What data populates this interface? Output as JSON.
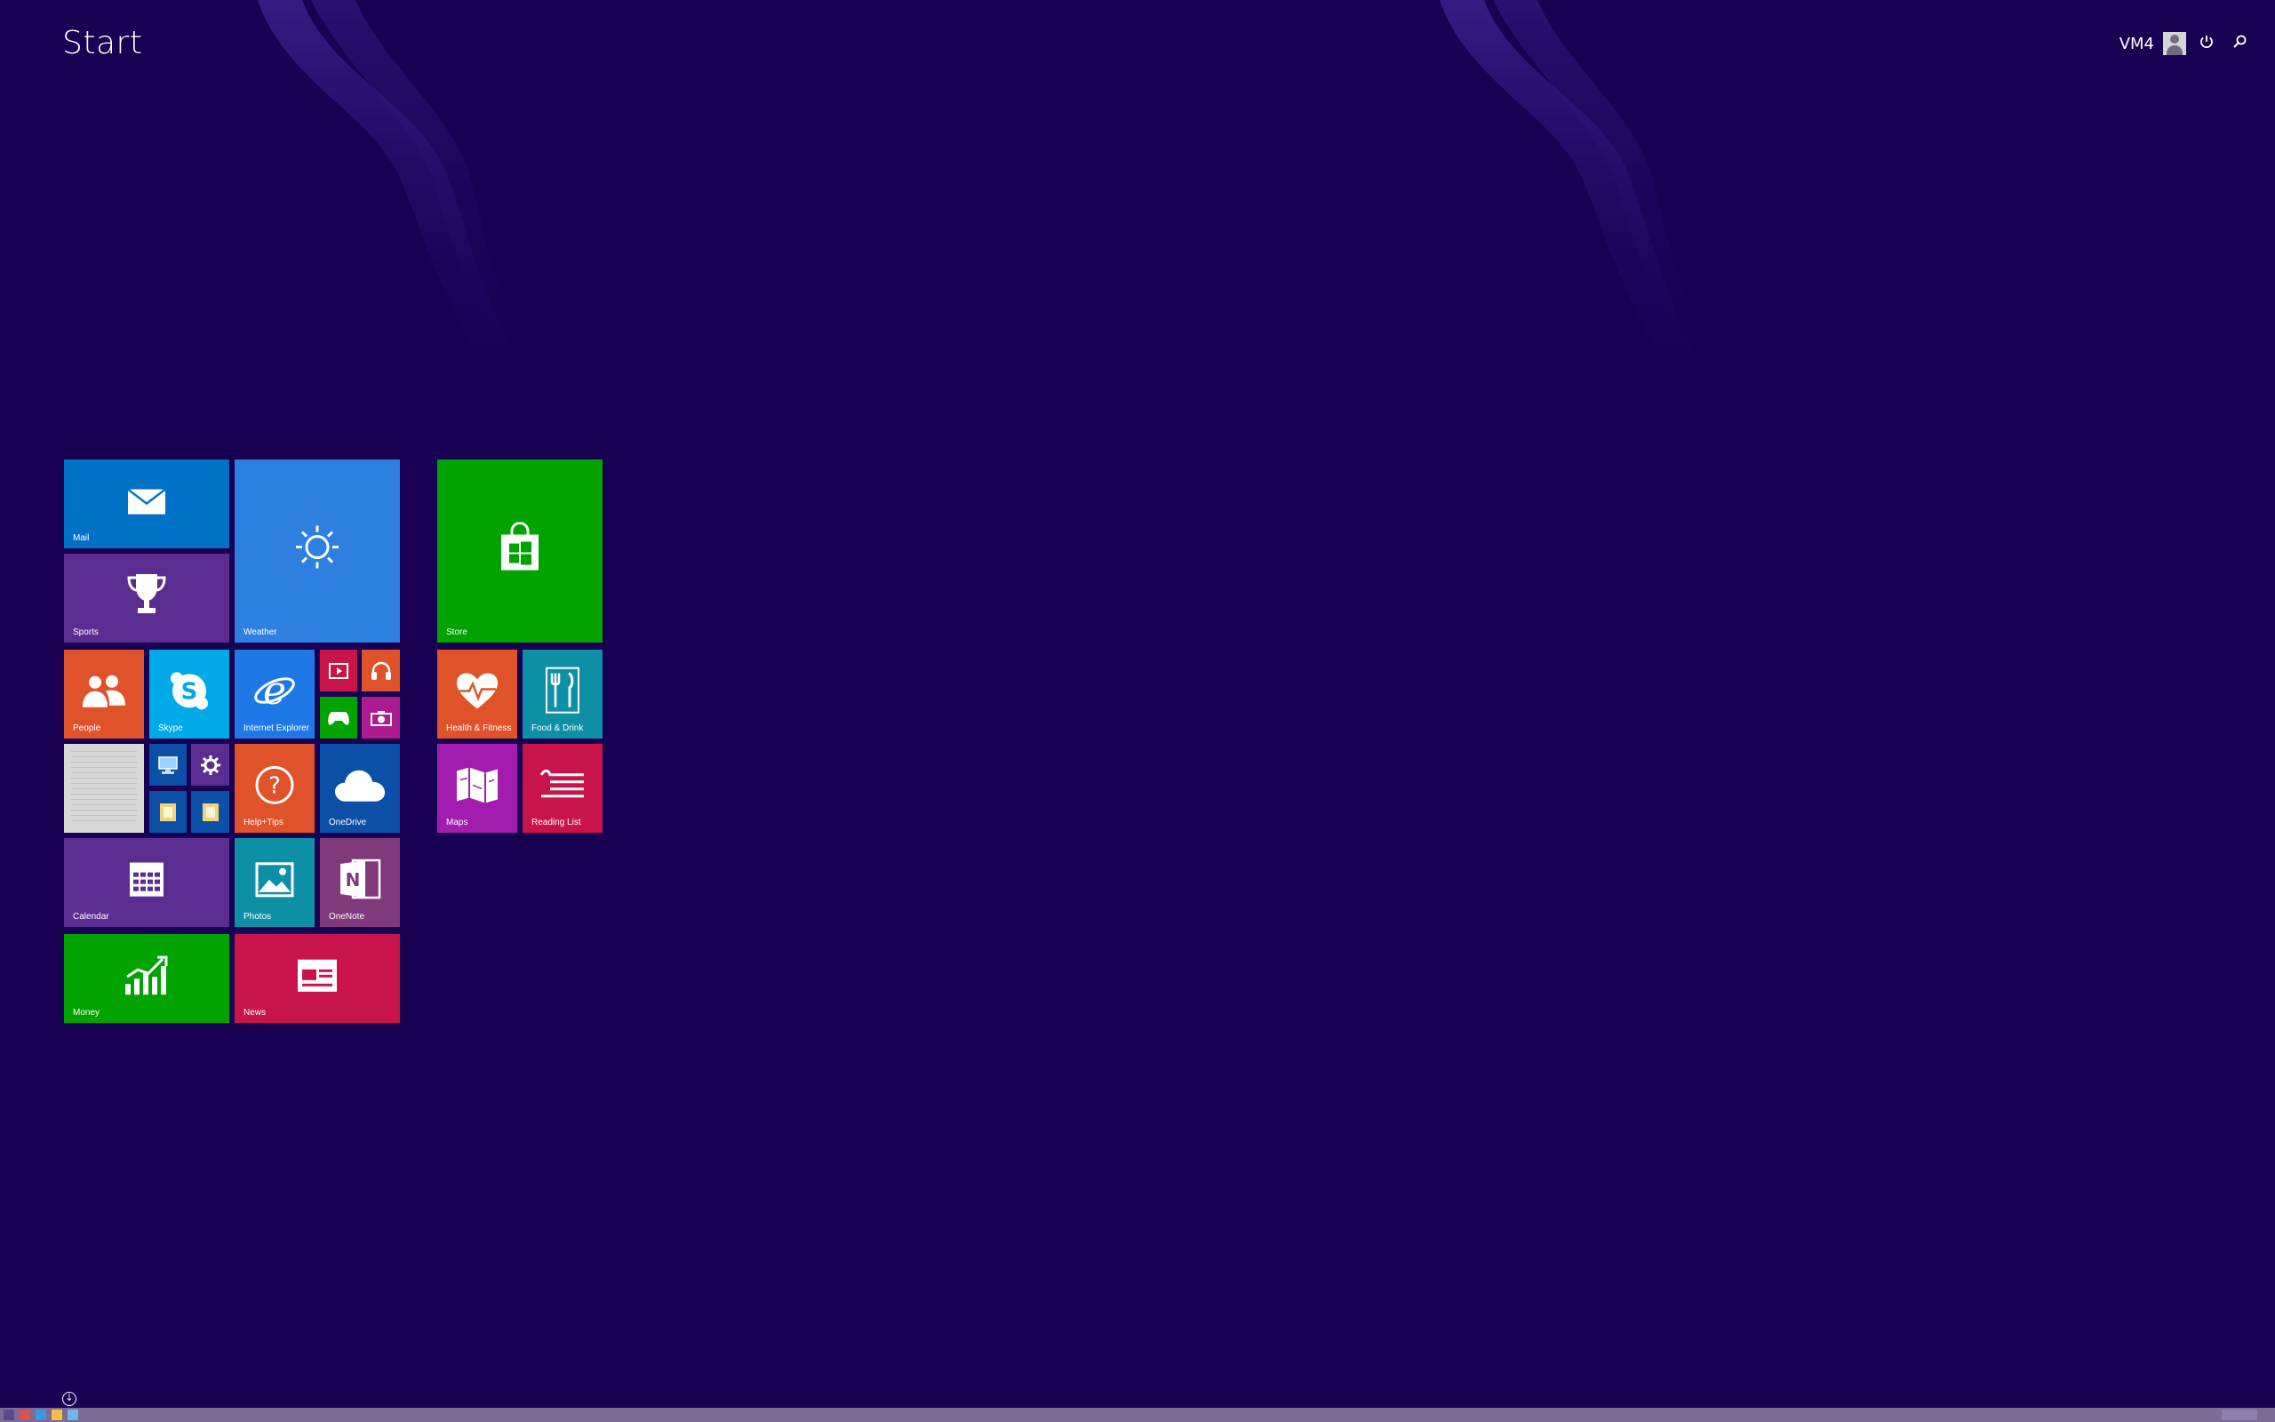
{
  "header": {
    "title": "Start",
    "user_name": "VM4",
    "power_icon": "power-icon",
    "search_icon": "search-icon"
  },
  "colors": {
    "background": "#180052",
    "taskbar": "#7d6b95"
  },
  "tiles": [
    {
      "id": "mail",
      "label": "Mail",
      "color": "#0072c6",
      "icon": "mail-icon"
    },
    {
      "id": "sports",
      "label": "Sports",
      "color": "#5c2d91",
      "icon": "trophy-icon"
    },
    {
      "id": "weather",
      "label": "Weather",
      "color": "#2d7fe0",
      "icon": "sun-icon"
    },
    {
      "id": "store",
      "label": "Store",
      "color": "#00a300",
      "icon": "store-bag-icon"
    },
    {
      "id": "people",
      "label": "People",
      "color": "#e0522a",
      "icon": "people-icon"
    },
    {
      "id": "skype",
      "label": "Skype",
      "color": "#00a9e8",
      "icon": "skype-icon"
    },
    {
      "id": "ie",
      "label": "Internet Explorer",
      "color": "#1e79e6",
      "icon": "ie-icon"
    },
    {
      "id": "video",
      "label": "",
      "color": "#c8134b",
      "icon": "video-icon"
    },
    {
      "id": "music",
      "label": "",
      "color": "#e0522a",
      "icon": "headphones-icon"
    },
    {
      "id": "games",
      "label": "",
      "color": "#00a300",
      "icon": "gamepad-icon"
    },
    {
      "id": "camera",
      "label": "",
      "color": "#ac1a8f",
      "icon": "camera-icon"
    },
    {
      "id": "health",
      "label": "Health & Fitness",
      "color": "#e0522a",
      "icon": "heart-pulse-icon"
    },
    {
      "id": "food",
      "label": "Food & Drink",
      "color": "#0d8fa6",
      "icon": "fork-knife-icon"
    },
    {
      "id": "desktop",
      "label": "",
      "color": "#d8d8d8",
      "icon": "desktop-thumbnail-icon"
    },
    {
      "id": "this-pc",
      "label": "",
      "color": "#0c4fa6",
      "icon": "computer-icon"
    },
    {
      "id": "pc-settings",
      "label": "",
      "color": "#5c2d91",
      "icon": "gear-icon"
    },
    {
      "id": "file-explorer",
      "label": "",
      "color": "#0c4fa6",
      "icon": "folder-icon"
    },
    {
      "id": "documents",
      "label": "",
      "color": "#0c4fa6",
      "icon": "folder-icon"
    },
    {
      "id": "help",
      "label": "Help+Tips",
      "color": "#e0522a",
      "icon": "question-icon"
    },
    {
      "id": "onedrive",
      "label": "OneDrive",
      "color": "#0c4fa6",
      "icon": "cloud-icon"
    },
    {
      "id": "maps",
      "label": "Maps",
      "color": "#a21caf",
      "icon": "map-icon"
    },
    {
      "id": "reading",
      "label": "Reading List",
      "color": "#c8134b",
      "icon": "reading-list-icon"
    },
    {
      "id": "calendar",
      "label": "Calendar",
      "color": "#5c2d91",
      "icon": "calendar-icon"
    },
    {
      "id": "photos",
      "label": "Photos",
      "color": "#0d8fa6",
      "icon": "photo-icon"
    },
    {
      "id": "onenote",
      "label": "OneNote",
      "color": "#80397b",
      "icon": "onenote-icon"
    },
    {
      "id": "money",
      "label": "Money",
      "color": "#00a300",
      "icon": "chart-up-icon"
    },
    {
      "id": "news",
      "label": "News",
      "color": "#c8134b",
      "icon": "newspaper-icon"
    }
  ]
}
